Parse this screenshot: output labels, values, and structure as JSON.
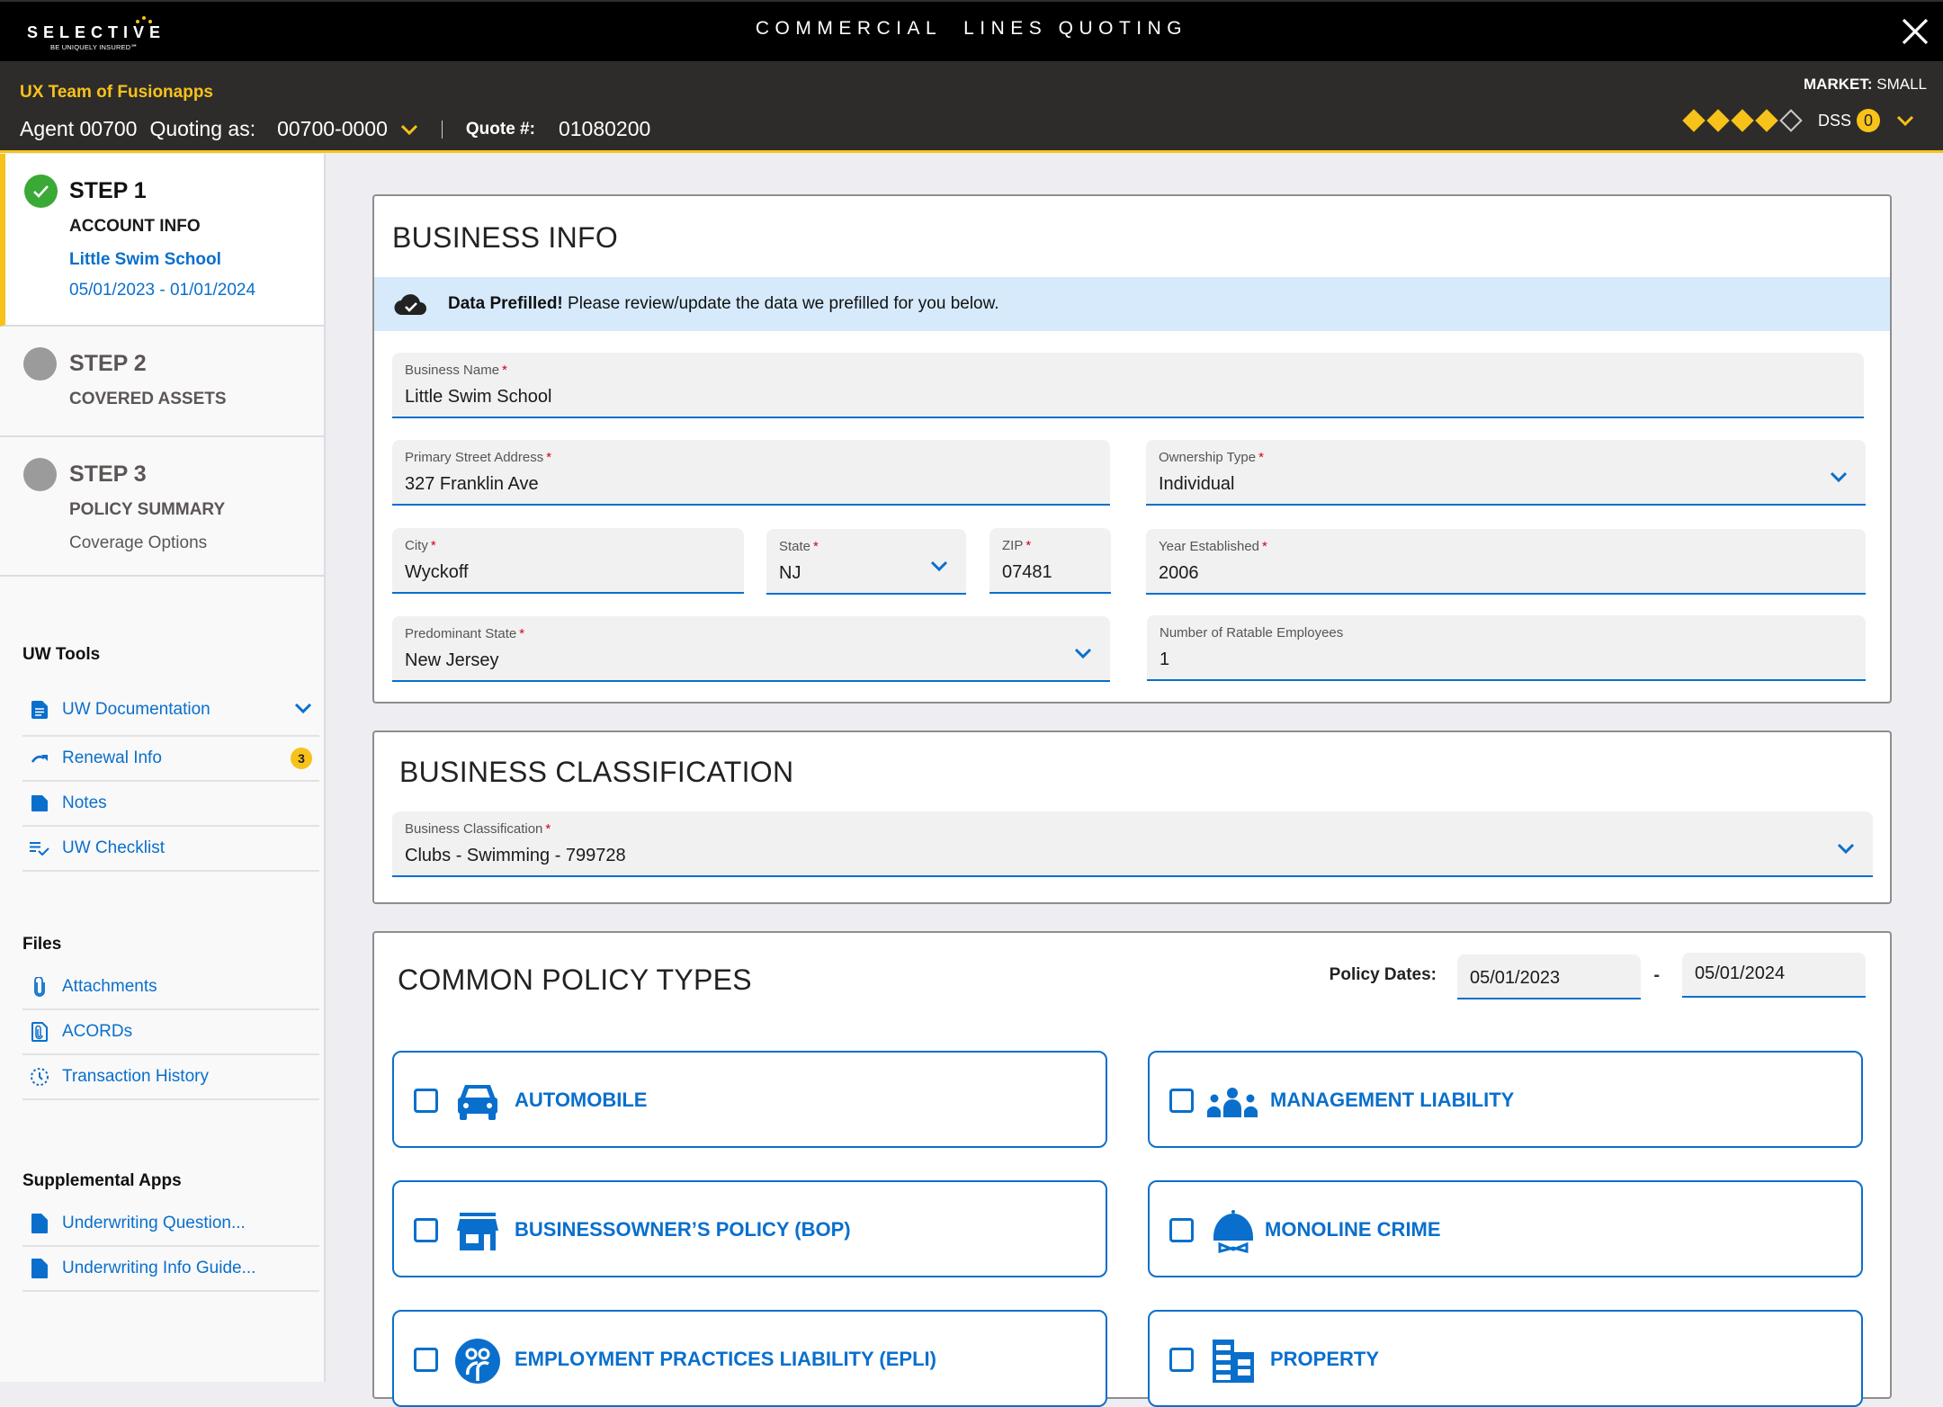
{
  "header": {
    "logo_word": "SELECTIVE",
    "logo_tagline": "BE UNIQUELY INSURED℠",
    "app_title": "COMMERCIAL  LINES QUOTING",
    "close_icon": "close-icon"
  },
  "subheader": {
    "org_name": "UX Team of Fusionapps",
    "agent_label": "Agent 00700",
    "quoting_as_label": "Quoting as:",
    "quoting_as_value": "00700-0000",
    "quote_label": "Quote #:",
    "quote_number": "01080200",
    "market_label": "MARKET:",
    "market_value": "SMALL",
    "rating": {
      "filled": 4,
      "total": 5
    },
    "dss_label": "DSS",
    "dss_count": "0"
  },
  "sidebar": {
    "steps": [
      {
        "title": "STEP 1",
        "subtitle": "ACCOUNT INFO",
        "account_name": "Little Swim School",
        "dates": "05/01/2023 - 01/01/2024",
        "status": "complete"
      },
      {
        "title": "STEP 2",
        "subtitle": "COVERED ASSETS",
        "status": "pending"
      },
      {
        "title": "STEP 3",
        "subtitle": "POLICY SUMMARY",
        "extra": "Coverage Options",
        "status": "pending"
      }
    ],
    "uw_tools": {
      "heading": "UW Tools",
      "items": [
        {
          "label": "UW Documentation",
          "icon": "document-icon",
          "expandable": true
        },
        {
          "label": "Renewal Info",
          "icon": "renewal-arrow-icon",
          "badge": "3"
        },
        {
          "label": "Notes",
          "icon": "note-icon"
        },
        {
          "label": "UW Checklist",
          "icon": "checklist-icon"
        }
      ]
    },
    "files": {
      "heading": "Files",
      "items": [
        {
          "label": "Attachments",
          "icon": "paperclip-icon"
        },
        {
          "label": "ACORDs",
          "icon": "attached-file-icon"
        },
        {
          "label": "Transaction History",
          "icon": "history-clock-icon"
        }
      ]
    },
    "supplemental": {
      "heading": "Supplemental Apps",
      "items": [
        {
          "label": "Underwriting Question...",
          "icon": "file-icon"
        },
        {
          "label": "Underwriting Info Guide...",
          "icon": "file-icon"
        }
      ]
    }
  },
  "business_info": {
    "title": "BUSINESS INFO",
    "banner_bold": "Data Prefilled!",
    "banner_text": " Please review/update the data we prefilled for you below.",
    "fields": {
      "business_name": {
        "label": "Business Name",
        "value": "Little Swim School",
        "required": true
      },
      "street": {
        "label": "Primary Street Address",
        "value": "327 Franklin Ave",
        "required": true
      },
      "ownership": {
        "label": "Ownership Type",
        "value": "Individual",
        "required": true
      },
      "city": {
        "label": "City",
        "value": "Wyckoff",
        "required": true
      },
      "state": {
        "label": "State",
        "value": "NJ",
        "required": true
      },
      "zip": {
        "label": "ZIP",
        "value": "07481",
        "required": true
      },
      "year": {
        "label": "Year Established",
        "value": "2006",
        "required": true
      },
      "predominant_state": {
        "label": "Predominant State",
        "value": "New Jersey",
        "required": true
      },
      "employees": {
        "label": "Number of Ratable Employees",
        "value": "1",
        "required": false
      }
    }
  },
  "business_classification": {
    "title": "BUSINESS CLASSIFICATION",
    "field": {
      "label": "Business Classification",
      "value": "Clubs - Swimming - 799728",
      "required": true
    }
  },
  "common_policy_types": {
    "title": "COMMON POLICY TYPES",
    "policy_dates_label": "Policy Dates:",
    "start_date": "05/01/2023",
    "end_date": "05/01/2024",
    "date_separator": "-",
    "types": [
      {
        "label": "AUTOMOBILE",
        "icon": "car-icon",
        "checked": false
      },
      {
        "label": "MANAGEMENT LIABILITY",
        "icon": "group-people-icon",
        "checked": false
      },
      {
        "label": "BUSINESSOWNER’S POLICY (BOP)",
        "icon": "storefront-icon",
        "checked": false
      },
      {
        "label": "MONOLINE CRIME",
        "icon": "burglar-mask-icon",
        "checked": false
      },
      {
        "label": "EMPLOYMENT PRACTICES LIABILITY (EPLI)",
        "icon": "employees-circle-icon",
        "checked": false
      },
      {
        "label": "PROPERTY",
        "icon": "building-icon",
        "checked": false
      }
    ]
  },
  "colors": {
    "brand_yellow": "#f7c21a",
    "link_blue": "#0a6fcc",
    "success_green": "#3aa935",
    "banner_blue": "#d6eafb"
  }
}
